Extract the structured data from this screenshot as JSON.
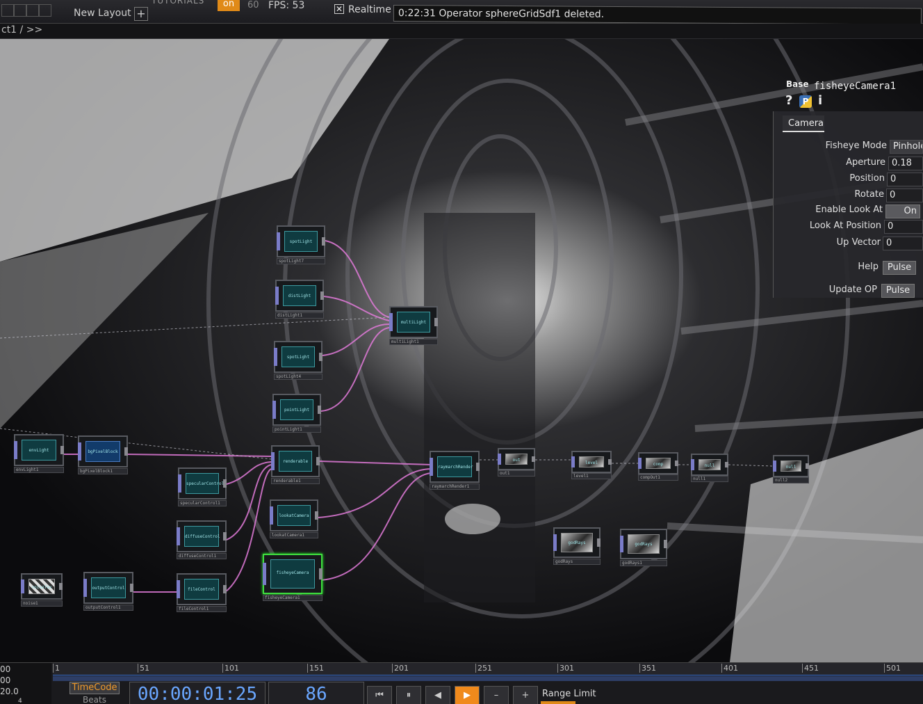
{
  "topbar": {
    "layout_label": "New Layout",
    "add_layout": "+",
    "tutorials_label": "TUTORIALS",
    "toggle_label": "on",
    "fps_cap": "60",
    "fps_label": "FPS:  53",
    "realtime_checked": "✕",
    "realtime_label": "Realtime",
    "status_message": "0:22:31 Operator sphereGridSdf1 deleted."
  },
  "pathbar": {
    "path": "ct1 / >>"
  },
  "network": {
    "nodes": [
      {
        "title": "spotLight",
        "label": "spotLight7"
      },
      {
        "title": "distLight",
        "label": "distLight1"
      },
      {
        "title": "multiLight",
        "label": "multiLight1"
      },
      {
        "title": "spotLight",
        "label": "spotLight4"
      },
      {
        "title": "pointLight",
        "label": "pointLight1"
      },
      {
        "title": "envLight",
        "label": "envLight1"
      },
      {
        "title": "bgPixelBlock",
        "label": "bgPixelBlock1"
      },
      {
        "title": "renderable",
        "label": "renderable1"
      },
      {
        "title": "specularControl",
        "label": "specularControl1"
      },
      {
        "title": "lookatCamera",
        "label": "lookatCamera1"
      },
      {
        "title": "diffuseControl",
        "label": "diffuseControl1"
      },
      {
        "title": "raymarchRender",
        "label": "raymarchRender1"
      },
      {
        "title": "fisheyeCamera",
        "label": "fisheyeCamera1"
      },
      {
        "title": "noiseTex",
        "label": "noise1"
      },
      {
        "title": "outputControl",
        "label": "outputControl1"
      },
      {
        "title": "fileControl",
        "label": "fileControl1"
      },
      {
        "title": "out",
        "label": "out1"
      },
      {
        "title": "level",
        "label": "level1"
      },
      {
        "title": "comp",
        "label": "compOut1"
      },
      {
        "title": "null",
        "label": "null1"
      },
      {
        "title": "null",
        "label": "null2"
      },
      {
        "title": "godRays",
        "label": "godRays"
      },
      {
        "title": "godRays",
        "label": "godRays1"
      }
    ]
  },
  "panel": {
    "op_type": "Base",
    "op_name": "fisheyeCamera1",
    "icon_help": "?",
    "icon_python": "P",
    "icon_info": "i",
    "page_tab": "Camera",
    "params": {
      "fisheye_mode": {
        "label": "Fisheye Mode",
        "value": "Pinhole"
      },
      "aperture": {
        "label": "Aperture",
        "value": "0.18"
      },
      "position": {
        "label": "Position",
        "value": "0"
      },
      "rotate": {
        "label": "Rotate",
        "value": "0"
      },
      "enable_look_at": {
        "label": "Enable Look At",
        "value": "On"
      },
      "look_at_position": {
        "label": "Look At Position",
        "value": "0"
      },
      "up_vector": {
        "label": "Up Vector",
        "value": "0"
      },
      "help": {
        "label": "Help",
        "value": "Pulse"
      },
      "update_op": {
        "label": "Update OP",
        "value": "Pulse"
      }
    }
  },
  "timeline": {
    "left_lines": [
      "00",
      "00",
      "20.0",
      "4"
    ],
    "ticks": [
      "1",
      "51",
      "101",
      "151",
      "201",
      "251",
      "301",
      "351",
      "401",
      "451",
      "501"
    ],
    "mode_timecode": "TimeCode",
    "mode_beats": "Beats",
    "timecode": "00:00:01:25",
    "frame": "86",
    "buttons": [
      "⏮",
      "⏸",
      "◀",
      "▶",
      "–",
      "+"
    ],
    "range_limit": "Range Limit"
  },
  "colors": {
    "accent_orange": "#f08a1c",
    "wire_pink": "#e07ad8",
    "selected_green": "#3fdc3f",
    "timecode_blue": "#6aa7ff"
  }
}
